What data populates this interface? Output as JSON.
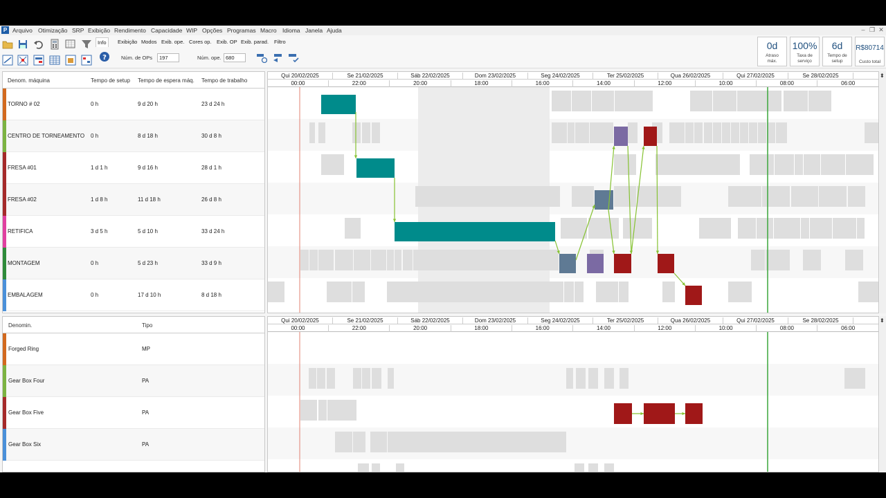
{
  "menu": {
    "logo": "P",
    "items": [
      "Arquivo",
      "Otimização",
      "SRP",
      "Exibição",
      "Rendimento",
      "Capacidade",
      "WIP",
      "Opções",
      "Programas",
      "Macro",
      "Idioma",
      "Janela",
      "Ajuda"
    ]
  },
  "toolbar": {
    "tabs": [
      "Info",
      "Exibição",
      "Modos",
      "Exib. ope.",
      "Cores op.",
      "Exib. OP",
      "Exib. parad.",
      "Filtro"
    ],
    "num_ops_label": "Núm. de OPs",
    "num_ops_value": "197",
    "num_ope_label": "Núm. ope.",
    "num_ope_value": "680"
  },
  "kpis": [
    {
      "value": "0d",
      "label1": "Atraso",
      "label2": "máx."
    },
    {
      "value": "100%",
      "label1": "Taxa de",
      "label2": "serviço"
    },
    {
      "value": "6d",
      "label1": "Tempo de",
      "label2": "setup"
    },
    {
      "value": "R$80714",
      "label1": "Custo total",
      "label2": ""
    }
  ],
  "machines_grid": {
    "headers": [
      "Denom. máquina",
      "Tempo de setup",
      "Tempo de espera máq.",
      "Tempo de trabalho"
    ],
    "rows": [
      {
        "name": "TORNO # 02",
        "setup": "0 h",
        "wait": "9 d 20 h",
        "work": "23 d 24 h",
        "color": "#d2691e"
      },
      {
        "name": "CENTRO DE TORNEAMENTO",
        "setup": "0 h",
        "wait": "8 d 18 h",
        "work": "30 d 8 h",
        "color": "#7cb342"
      },
      {
        "name": "FRESA #01",
        "setup": "1 d 1 h",
        "wait": "9 d 16 h",
        "work": "28 d 1 h",
        "color": "#a52a2a"
      },
      {
        "name": "FRESA #02",
        "setup": "1 d 8 h",
        "wait": "11 d 18 h",
        "work": "26 d 8 h",
        "color": "#a52a2a"
      },
      {
        "name": "RETIFICA",
        "setup": "3 d 5 h",
        "wait": "5 d 10 h",
        "work": "33 d 24 h",
        "color": "#e040a0"
      },
      {
        "name": "MONTAGEM",
        "setup": "0 h",
        "wait": "5 d 23 h",
        "work": "33 d 9 h",
        "color": "#2e8b3a"
      },
      {
        "name": "EMBALAGEM",
        "setup": "0 h",
        "wait": "17 d 10 h",
        "work": "8 d 18 h",
        "color": "#4a90d9"
      }
    ]
  },
  "products_grid": {
    "headers": [
      "Denomin.",
      "Tipo"
    ],
    "rows": [
      {
        "name": "Forged Ring",
        "type": "MP",
        "color": "#d2691e"
      },
      {
        "name": "Gear Box Four",
        "type": "PA",
        "color": "#7cb342"
      },
      {
        "name": "Gear Box Five",
        "type": "PA",
        "color": "#a52a2a"
      },
      {
        "name": "Gear Box Six",
        "type": "PA",
        "color": "#4a90d9"
      }
    ]
  },
  "timeline": {
    "days": [
      "Qui 20/02/2025",
      "Se 21/02/2025",
      "Sáb 22/02/2025",
      "Dom 23/02/2025",
      "Seg 24/02/2025",
      "Ter 25/02/2025",
      "Qua 26/02/2025",
      "Qui 27/02/2025",
      "Se 28/02/2025",
      "Sá"
    ],
    "hours": [
      "00:00",
      "22:00",
      "20:00",
      "18:00",
      "16:00",
      "14:00",
      "12:00",
      "10:00",
      "08:00",
      "06:00"
    ]
  },
  "colors": {
    "teal": "#008b8b",
    "slate": "#5f7a94",
    "purple": "#7b6aa3",
    "crimson": "#a01818",
    "idle_block": "#dedede",
    "link": "#86c232",
    "now_line": "#3aa53a",
    "start_line": "#e08070"
  }
}
